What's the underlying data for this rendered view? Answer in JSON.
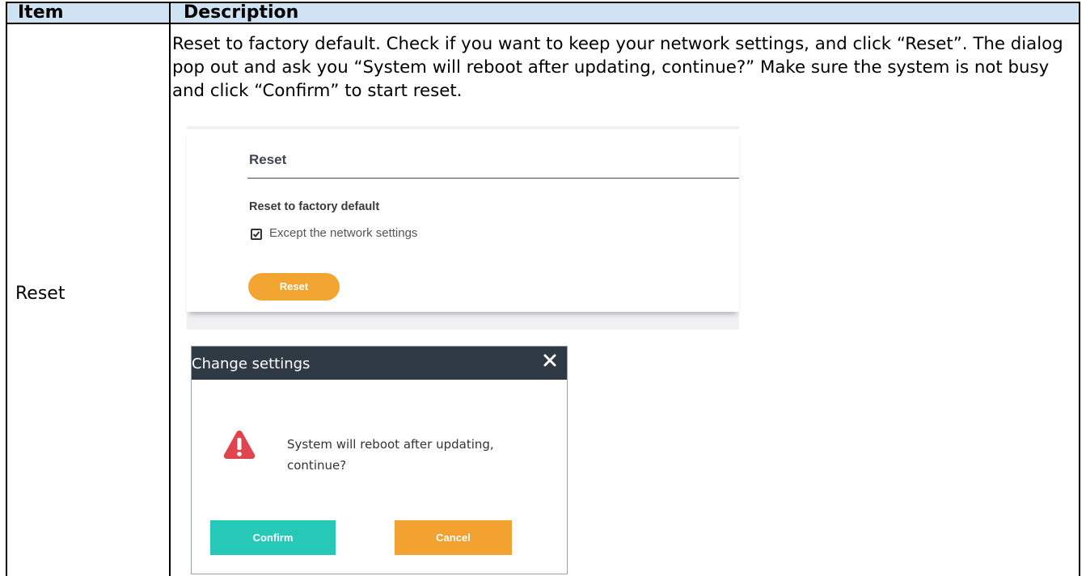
{
  "table": {
    "header_item": "Item",
    "header_description": "Description",
    "item": "Reset",
    "description": "Reset to factory default. Check if you want to keep your network settings, and click “Reset”. The dialog pop out and ask you “System will reboot after updating, continue?” Make sure the system is not busy and click “Confirm” to start reset."
  },
  "reset_panel": {
    "title": "Reset",
    "subtitle": "Reset to factory default",
    "checkbox_label": "Except the network settings",
    "checkbox_checked": true,
    "button_label": "Reset",
    "button_color": "#f2a530"
  },
  "dialog": {
    "title": "Change settings",
    "close_icon": "close-icon",
    "warning_icon": "warning-icon",
    "message": "System will reboot after updating, continue?",
    "confirm_label": "Confirm",
    "cancel_label": "Cancel",
    "header_color": "#2f3a45",
    "confirm_color": "#26c9b8",
    "cancel_color": "#f2a230"
  }
}
